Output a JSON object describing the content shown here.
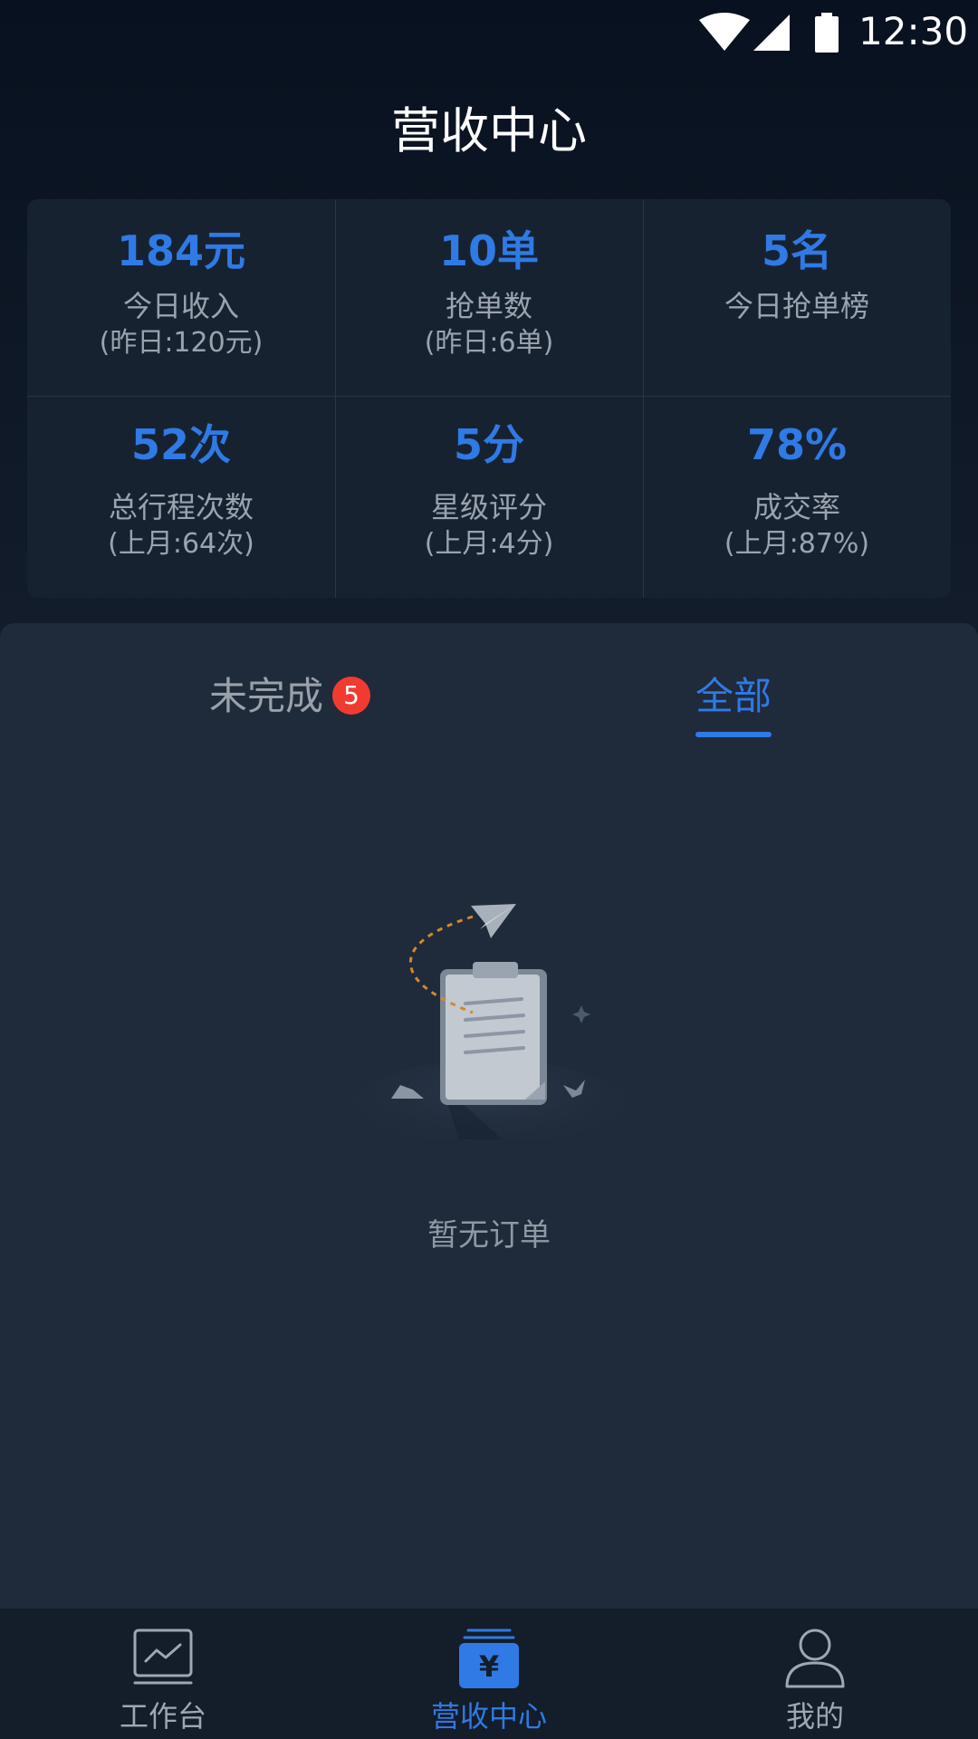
{
  "status_bar": {
    "time": "12:30",
    "icons": [
      "wifi-icon",
      "cellular-signal-icon",
      "battery-icon"
    ]
  },
  "header": {
    "title": "营收中心"
  },
  "stats": [
    {
      "value": "184元",
      "label": "今日收入",
      "sub": "(昨日:120元)"
    },
    {
      "value": "10单",
      "label": "抢单数",
      "sub": "(昨日:6单)"
    },
    {
      "value": "5名",
      "label": "今日抢单榜",
      "sub": ""
    },
    {
      "value": "52次",
      "label": "总行程次数",
      "sub": "(上月:64次)"
    },
    {
      "value": "5分",
      "label": "星级评分",
      "sub": "(上月:4分)"
    },
    {
      "value": "78%",
      "label": "成交率",
      "sub": "(上月:87%)"
    }
  ],
  "tabs": {
    "incomplete_label": "未完成",
    "incomplete_badge": "5",
    "all_label": "全部",
    "active": "all"
  },
  "empty_state": {
    "text": "暂无订单",
    "icon": "empty-clipboard-illustration"
  },
  "bottom_nav": [
    {
      "label": "工作台",
      "icon": "chart-monitor-icon",
      "active": false
    },
    {
      "label": "营收中心",
      "icon": "yuan-wallet-icon",
      "active": true
    },
    {
      "label": "我的",
      "icon": "user-profile-icon",
      "active": false
    }
  ],
  "colors": {
    "accent": "#2f7ae5",
    "badge": "#f23b30",
    "header_bg": "#08111f",
    "panel_bg": "#1f2a3a",
    "nav_bg": "#141d2a"
  }
}
